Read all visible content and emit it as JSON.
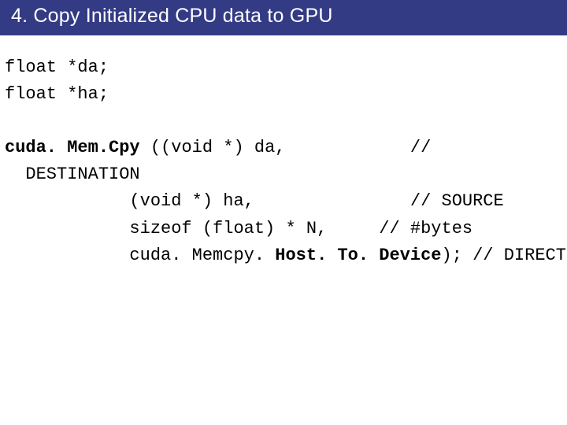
{
  "title": "4. Copy Initialized CPU data to GPU",
  "code": {
    "line1": "float *da;",
    "line2": "float *ha;",
    "bold_func": "cuda. Mem.Cpy",
    "line3a": " ((void *) da,            //",
    "line3b": "  DESTINATION",
    "line4": "            (void *) ha,               // SOURCE",
    "line5": "            sizeof (float) * N,     // #bytes",
    "line6a": "            cuda. Memcpy. ",
    "bold_dir": "Host. To. Device",
    "line6b": "); // DIRECTION"
  }
}
